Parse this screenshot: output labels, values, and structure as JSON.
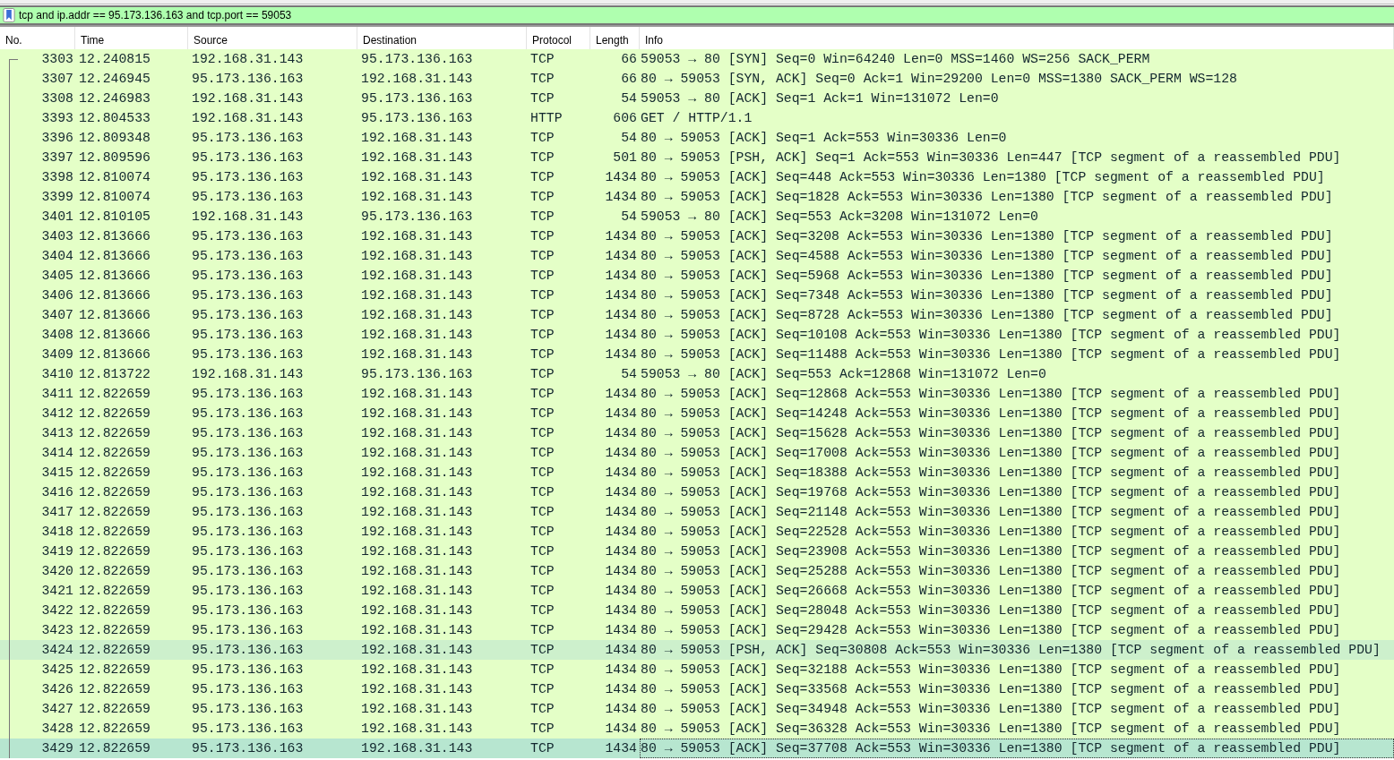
{
  "filter": {
    "value": "tcp and ip.addr == 95.173.136.163 and tcp.port == 59053"
  },
  "columns": [
    "No.",
    "Time",
    "Source",
    "Destination",
    "Protocol",
    "Length",
    "Info"
  ],
  "rows": [
    {
      "no": "3303",
      "time": "12.240815",
      "source": "192.168.31.143",
      "destination": "95.173.136.163",
      "protocol": "TCP",
      "length": "66",
      "info": "59053 → 80 [SYN] Seq=0 Win=64240 Len=0 MSS=1460 WS=256 SACK_PERM",
      "selected": false,
      "hovered": false
    },
    {
      "no": "3307",
      "time": "12.246945",
      "source": "95.173.136.163",
      "destination": "192.168.31.143",
      "protocol": "TCP",
      "length": "66",
      "info": "80 → 59053 [SYN, ACK] Seq=0 Ack=1 Win=29200 Len=0 MSS=1380 SACK_PERM WS=128",
      "selected": false,
      "hovered": false
    },
    {
      "no": "3308",
      "time": "12.246983",
      "source": "192.168.31.143",
      "destination": "95.173.136.163",
      "protocol": "TCP",
      "length": "54",
      "info": "59053 → 80 [ACK] Seq=1 Ack=1 Win=131072 Len=0",
      "selected": false,
      "hovered": false
    },
    {
      "no": "3393",
      "time": "12.804533",
      "source": "192.168.31.143",
      "destination": "95.173.136.163",
      "protocol": "HTTP",
      "length": "606",
      "info": "GET / HTTP/1.1",
      "selected": false,
      "hovered": false
    },
    {
      "no": "3396",
      "time": "12.809348",
      "source": "95.173.136.163",
      "destination": "192.168.31.143",
      "protocol": "TCP",
      "length": "54",
      "info": "80 → 59053 [ACK] Seq=1 Ack=553 Win=30336 Len=0",
      "selected": false,
      "hovered": false
    },
    {
      "no": "3397",
      "time": "12.809596",
      "source": "95.173.136.163",
      "destination": "192.168.31.143",
      "protocol": "TCP",
      "length": "501",
      "info": "80 → 59053 [PSH, ACK] Seq=1 Ack=553 Win=30336 Len=447 [TCP segment of a reassembled PDU]",
      "selected": false,
      "hovered": false
    },
    {
      "no": "3398",
      "time": "12.810074",
      "source": "95.173.136.163",
      "destination": "192.168.31.143",
      "protocol": "TCP",
      "length": "1434",
      "info": "80 → 59053 [ACK] Seq=448 Ack=553 Win=30336 Len=1380 [TCP segment of a reassembled PDU]",
      "selected": false,
      "hovered": false
    },
    {
      "no": "3399",
      "time": "12.810074",
      "source": "95.173.136.163",
      "destination": "192.168.31.143",
      "protocol": "TCP",
      "length": "1434",
      "info": "80 → 59053 [ACK] Seq=1828 Ack=553 Win=30336 Len=1380 [TCP segment of a reassembled PDU]",
      "selected": false,
      "hovered": false
    },
    {
      "no": "3401",
      "time": "12.810105",
      "source": "192.168.31.143",
      "destination": "95.173.136.163",
      "protocol": "TCP",
      "length": "54",
      "info": "59053 → 80 [ACK] Seq=553 Ack=3208 Win=131072 Len=0",
      "selected": false,
      "hovered": false
    },
    {
      "no": "3403",
      "time": "12.813666",
      "source": "95.173.136.163",
      "destination": "192.168.31.143",
      "protocol": "TCP",
      "length": "1434",
      "info": "80 → 59053 [ACK] Seq=3208 Ack=553 Win=30336 Len=1380 [TCP segment of a reassembled PDU]",
      "selected": false,
      "hovered": false
    },
    {
      "no": "3404",
      "time": "12.813666",
      "source": "95.173.136.163",
      "destination": "192.168.31.143",
      "protocol": "TCP",
      "length": "1434",
      "info": "80 → 59053 [ACK] Seq=4588 Ack=553 Win=30336 Len=1380 [TCP segment of a reassembled PDU]",
      "selected": false,
      "hovered": false
    },
    {
      "no": "3405",
      "time": "12.813666",
      "source": "95.173.136.163",
      "destination": "192.168.31.143",
      "protocol": "TCP",
      "length": "1434",
      "info": "80 → 59053 [ACK] Seq=5968 Ack=553 Win=30336 Len=1380 [TCP segment of a reassembled PDU]",
      "selected": false,
      "hovered": false
    },
    {
      "no": "3406",
      "time": "12.813666",
      "source": "95.173.136.163",
      "destination": "192.168.31.143",
      "protocol": "TCP",
      "length": "1434",
      "info": "80 → 59053 [ACK] Seq=7348 Ack=553 Win=30336 Len=1380 [TCP segment of a reassembled PDU]",
      "selected": false,
      "hovered": false
    },
    {
      "no": "3407",
      "time": "12.813666",
      "source": "95.173.136.163",
      "destination": "192.168.31.143",
      "protocol": "TCP",
      "length": "1434",
      "info": "80 → 59053 [ACK] Seq=8728 Ack=553 Win=30336 Len=1380 [TCP segment of a reassembled PDU]",
      "selected": false,
      "hovered": false
    },
    {
      "no": "3408",
      "time": "12.813666",
      "source": "95.173.136.163",
      "destination": "192.168.31.143",
      "protocol": "TCP",
      "length": "1434",
      "info": "80 → 59053 [ACK] Seq=10108 Ack=553 Win=30336 Len=1380 [TCP segment of a reassembled PDU]",
      "selected": false,
      "hovered": false
    },
    {
      "no": "3409",
      "time": "12.813666",
      "source": "95.173.136.163",
      "destination": "192.168.31.143",
      "protocol": "TCP",
      "length": "1434",
      "info": "80 → 59053 [ACK] Seq=11488 Ack=553 Win=30336 Len=1380 [TCP segment of a reassembled PDU]",
      "selected": false,
      "hovered": false
    },
    {
      "no": "3410",
      "time": "12.813722",
      "source": "192.168.31.143",
      "destination": "95.173.136.163",
      "protocol": "TCP",
      "length": "54",
      "info": "59053 → 80 [ACK] Seq=553 Ack=12868 Win=131072 Len=0",
      "selected": false,
      "hovered": false
    },
    {
      "no": "3411",
      "time": "12.822659",
      "source": "95.173.136.163",
      "destination": "192.168.31.143",
      "protocol": "TCP",
      "length": "1434",
      "info": "80 → 59053 [ACK] Seq=12868 Ack=553 Win=30336 Len=1380 [TCP segment of a reassembled PDU]",
      "selected": false,
      "hovered": false
    },
    {
      "no": "3412",
      "time": "12.822659",
      "source": "95.173.136.163",
      "destination": "192.168.31.143",
      "protocol": "TCP",
      "length": "1434",
      "info": "80 → 59053 [ACK] Seq=14248 Ack=553 Win=30336 Len=1380 [TCP segment of a reassembled PDU]",
      "selected": false,
      "hovered": false
    },
    {
      "no": "3413",
      "time": "12.822659",
      "source": "95.173.136.163",
      "destination": "192.168.31.143",
      "protocol": "TCP",
      "length": "1434",
      "info": "80 → 59053 [ACK] Seq=15628 Ack=553 Win=30336 Len=1380 [TCP segment of a reassembled PDU]",
      "selected": false,
      "hovered": false
    },
    {
      "no": "3414",
      "time": "12.822659",
      "source": "95.173.136.163",
      "destination": "192.168.31.143",
      "protocol": "TCP",
      "length": "1434",
      "info": "80 → 59053 [ACK] Seq=17008 Ack=553 Win=30336 Len=1380 [TCP segment of a reassembled PDU]",
      "selected": false,
      "hovered": false
    },
    {
      "no": "3415",
      "time": "12.822659",
      "source": "95.173.136.163",
      "destination": "192.168.31.143",
      "protocol": "TCP",
      "length": "1434",
      "info": "80 → 59053 [ACK] Seq=18388 Ack=553 Win=30336 Len=1380 [TCP segment of a reassembled PDU]",
      "selected": false,
      "hovered": false
    },
    {
      "no": "3416",
      "time": "12.822659",
      "source": "95.173.136.163",
      "destination": "192.168.31.143",
      "protocol": "TCP",
      "length": "1434",
      "info": "80 → 59053 [ACK] Seq=19768 Ack=553 Win=30336 Len=1380 [TCP segment of a reassembled PDU]",
      "selected": false,
      "hovered": false
    },
    {
      "no": "3417",
      "time": "12.822659",
      "source": "95.173.136.163",
      "destination": "192.168.31.143",
      "protocol": "TCP",
      "length": "1434",
      "info": "80 → 59053 [ACK] Seq=21148 Ack=553 Win=30336 Len=1380 [TCP segment of a reassembled PDU]",
      "selected": false,
      "hovered": false
    },
    {
      "no": "3418",
      "time": "12.822659",
      "source": "95.173.136.163",
      "destination": "192.168.31.143",
      "protocol": "TCP",
      "length": "1434",
      "info": "80 → 59053 [ACK] Seq=22528 Ack=553 Win=30336 Len=1380 [TCP segment of a reassembled PDU]",
      "selected": false,
      "hovered": false
    },
    {
      "no": "3419",
      "time": "12.822659",
      "source": "95.173.136.163",
      "destination": "192.168.31.143",
      "protocol": "TCP",
      "length": "1434",
      "info": "80 → 59053 [ACK] Seq=23908 Ack=553 Win=30336 Len=1380 [TCP segment of a reassembled PDU]",
      "selected": false,
      "hovered": false
    },
    {
      "no": "3420",
      "time": "12.822659",
      "source": "95.173.136.163",
      "destination": "192.168.31.143",
      "protocol": "TCP",
      "length": "1434",
      "info": "80 → 59053 [ACK] Seq=25288 Ack=553 Win=30336 Len=1380 [TCP segment of a reassembled PDU]",
      "selected": false,
      "hovered": false
    },
    {
      "no": "3421",
      "time": "12.822659",
      "source": "95.173.136.163",
      "destination": "192.168.31.143",
      "protocol": "TCP",
      "length": "1434",
      "info": "80 → 59053 [ACK] Seq=26668 Ack=553 Win=30336 Len=1380 [TCP segment of a reassembled PDU]",
      "selected": false,
      "hovered": false
    },
    {
      "no": "3422",
      "time": "12.822659",
      "source": "95.173.136.163",
      "destination": "192.168.31.143",
      "protocol": "TCP",
      "length": "1434",
      "info": "80 → 59053 [ACK] Seq=28048 Ack=553 Win=30336 Len=1380 [TCP segment of a reassembled PDU]",
      "selected": false,
      "hovered": false
    },
    {
      "no": "3423",
      "time": "12.822659",
      "source": "95.173.136.163",
      "destination": "192.168.31.143",
      "protocol": "TCP",
      "length": "1434",
      "info": "80 → 59053 [ACK] Seq=29428 Ack=553 Win=30336 Len=1380 [TCP segment of a reassembled PDU]",
      "selected": false,
      "hovered": false
    },
    {
      "no": "3424",
      "time": "12.822659",
      "source": "95.173.136.163",
      "destination": "192.168.31.143",
      "protocol": "TCP",
      "length": "1434",
      "info": "80 → 59053 [PSH, ACK] Seq=30808 Ack=553 Win=30336 Len=1380 [TCP segment of a reassembled PDU]",
      "selected": false,
      "hovered": true
    },
    {
      "no": "3425",
      "time": "12.822659",
      "source": "95.173.136.163",
      "destination": "192.168.31.143",
      "protocol": "TCP",
      "length": "1434",
      "info": "80 → 59053 [ACK] Seq=32188 Ack=553 Win=30336 Len=1380 [TCP segment of a reassembled PDU]",
      "selected": false,
      "hovered": false
    },
    {
      "no": "3426",
      "time": "12.822659",
      "source": "95.173.136.163",
      "destination": "192.168.31.143",
      "protocol": "TCP",
      "length": "1434",
      "info": "80 → 59053 [ACK] Seq=33568 Ack=553 Win=30336 Len=1380 [TCP segment of a reassembled PDU]",
      "selected": false,
      "hovered": false
    },
    {
      "no": "3427",
      "time": "12.822659",
      "source": "95.173.136.163",
      "destination": "192.168.31.143",
      "protocol": "TCP",
      "length": "1434",
      "info": "80 → 59053 [ACK] Seq=34948 Ack=553 Win=30336 Len=1380 [TCP segment of a reassembled PDU]",
      "selected": false,
      "hovered": false
    },
    {
      "no": "3428",
      "time": "12.822659",
      "source": "95.173.136.163",
      "destination": "192.168.31.143",
      "protocol": "TCP",
      "length": "1434",
      "info": "80 → 59053 [ACK] Seq=36328 Ack=553 Win=30336 Len=1380 [TCP segment of a reassembled PDU]",
      "selected": false,
      "hovered": false
    },
    {
      "no": "3429",
      "time": "12.822659",
      "source": "95.173.136.163",
      "destination": "192.168.31.143",
      "protocol": "TCP",
      "length": "1434",
      "info": "80 → 59053 [ACK] Seq=37708 Ack=553 Win=30336 Len=1380 [TCP segment of a reassembled PDU]",
      "selected": true,
      "hovered": false
    }
  ]
}
